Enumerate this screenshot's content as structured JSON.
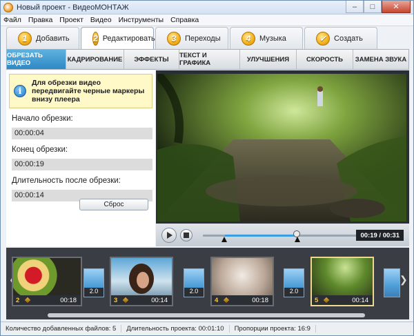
{
  "window": {
    "title": "Новый проект - ВидеоМОНТАЖ"
  },
  "menu": [
    "Файл",
    "Правка",
    "Проект",
    "Видео",
    "Инструменты",
    "Справка"
  ],
  "steps": [
    {
      "num": "1",
      "label": "Добавить"
    },
    {
      "num": "2",
      "label": "Редактировать"
    },
    {
      "num": "3",
      "label": "Переходы"
    },
    {
      "num": "4",
      "label": "Музыка"
    },
    {
      "num": "✓",
      "label": "Создать"
    }
  ],
  "subtabs": [
    "ОБРЕЗАТЬ ВИДЕО",
    "КАДРИРОВАНИЕ",
    "ЭФФЕКТЫ",
    "ТЕКСТ И ГРАФИКА",
    "УЛУЧШЕНИЯ",
    "СКОРОСТЬ",
    "ЗАМЕНА ЗВУКА"
  ],
  "trim": {
    "hint": "Для обрезки видео передвигайте черные маркеры внизу плеера",
    "start_label": "Начало обрезки:",
    "start_value": "00:00:04",
    "end_label": "Конец обрезки:",
    "end_value": "00:00:19",
    "duration_label": "Длительность после обрезки:",
    "duration_value": "00:00:14",
    "reset_label": "Сброс"
  },
  "player": {
    "time": "00:19 / 00:31"
  },
  "clips": [
    {
      "n": "2",
      "duration": "00:18"
    },
    {
      "n": "3",
      "duration": "00:14"
    },
    {
      "n": "4",
      "duration": "00:18"
    },
    {
      "n": "5",
      "duration": "00:14"
    }
  ],
  "transitions": [
    "2.0",
    "2.0",
    "2.0"
  ],
  "status": {
    "files": "Количество добавленных файлов: 5",
    "duration": "Длительность проекта: 00:01:10",
    "ratio": "Пропорции проекта: 16:9"
  }
}
